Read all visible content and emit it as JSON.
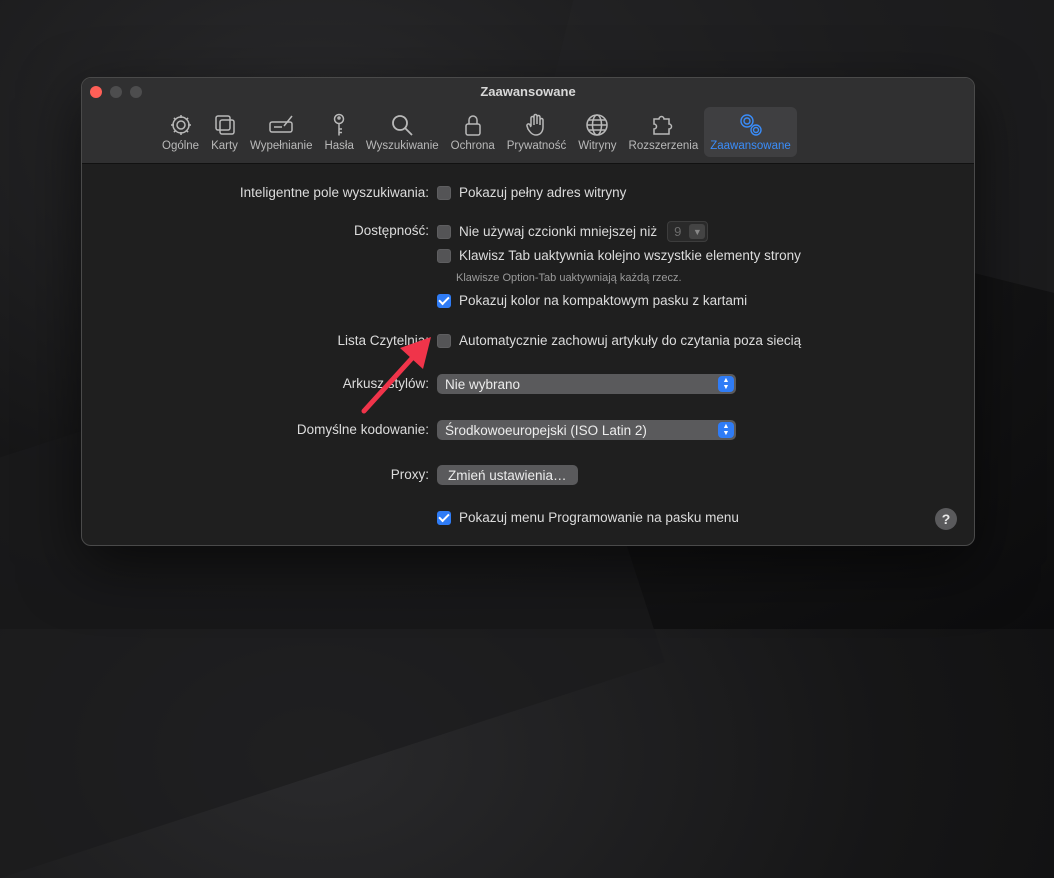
{
  "window": {
    "title": "Zaawansowane"
  },
  "toolbar": {
    "tabs": [
      {
        "label": "Ogólne",
        "icon": "gear-icon"
      },
      {
        "label": "Karty",
        "icon": "tabs-icon"
      },
      {
        "label": "Wypełnianie",
        "icon": "pen-field-icon"
      },
      {
        "label": "Hasła",
        "icon": "key-icon"
      },
      {
        "label": "Wyszukiwanie",
        "icon": "magnifier-icon"
      },
      {
        "label": "Ochrona",
        "icon": "lock-icon"
      },
      {
        "label": "Prywatność",
        "icon": "hand-icon"
      },
      {
        "label": "Witryny",
        "icon": "globe-icon"
      },
      {
        "label": "Rozszerzenia",
        "icon": "puzzle-icon"
      },
      {
        "label": "Zaawansowane",
        "icon": "gears-icon"
      }
    ],
    "active_tab": "Zaawansowane"
  },
  "settings": {
    "smart_search": {
      "label": "Inteligentne pole wyszukiwania:",
      "option": "Pokazuj pełny adres witryny",
      "checked": false
    },
    "accessibility": {
      "label": "Dostępność:",
      "min_font": {
        "option": "Nie używaj czcionki mniejszej niż",
        "checked": false,
        "value": "9"
      },
      "tab_key": {
        "option": "Klawisz Tab uaktywnia kolejno wszystkie elementy strony",
        "checked": false
      },
      "hint": "Klawisze Option-Tab uaktywniają każdą rzecz.",
      "compact_color": {
        "option": "Pokazuj kolor na kompaktowym pasku z kartami",
        "checked": true
      }
    },
    "reading_list": {
      "label": "Lista Czytelnia:",
      "option": "Automatycznie zachowuj artykuły do czytania poza siecią",
      "checked": false
    },
    "stylesheet": {
      "label": "Arkusz stylów:",
      "value": "Nie wybrano"
    },
    "encoding": {
      "label": "Domyślne kodowanie:",
      "value": "Środkowoeuropejski (ISO Latin 2)"
    },
    "proxy": {
      "label": "Proxy:",
      "button": "Zmień ustawienia…"
    },
    "develop_menu": {
      "option": "Pokazuj menu Programowanie na pasku menu",
      "checked": true
    },
    "help": "?"
  },
  "colors": {
    "accent": "#2f7cf6",
    "annotation_arrow": "#f0344a"
  }
}
